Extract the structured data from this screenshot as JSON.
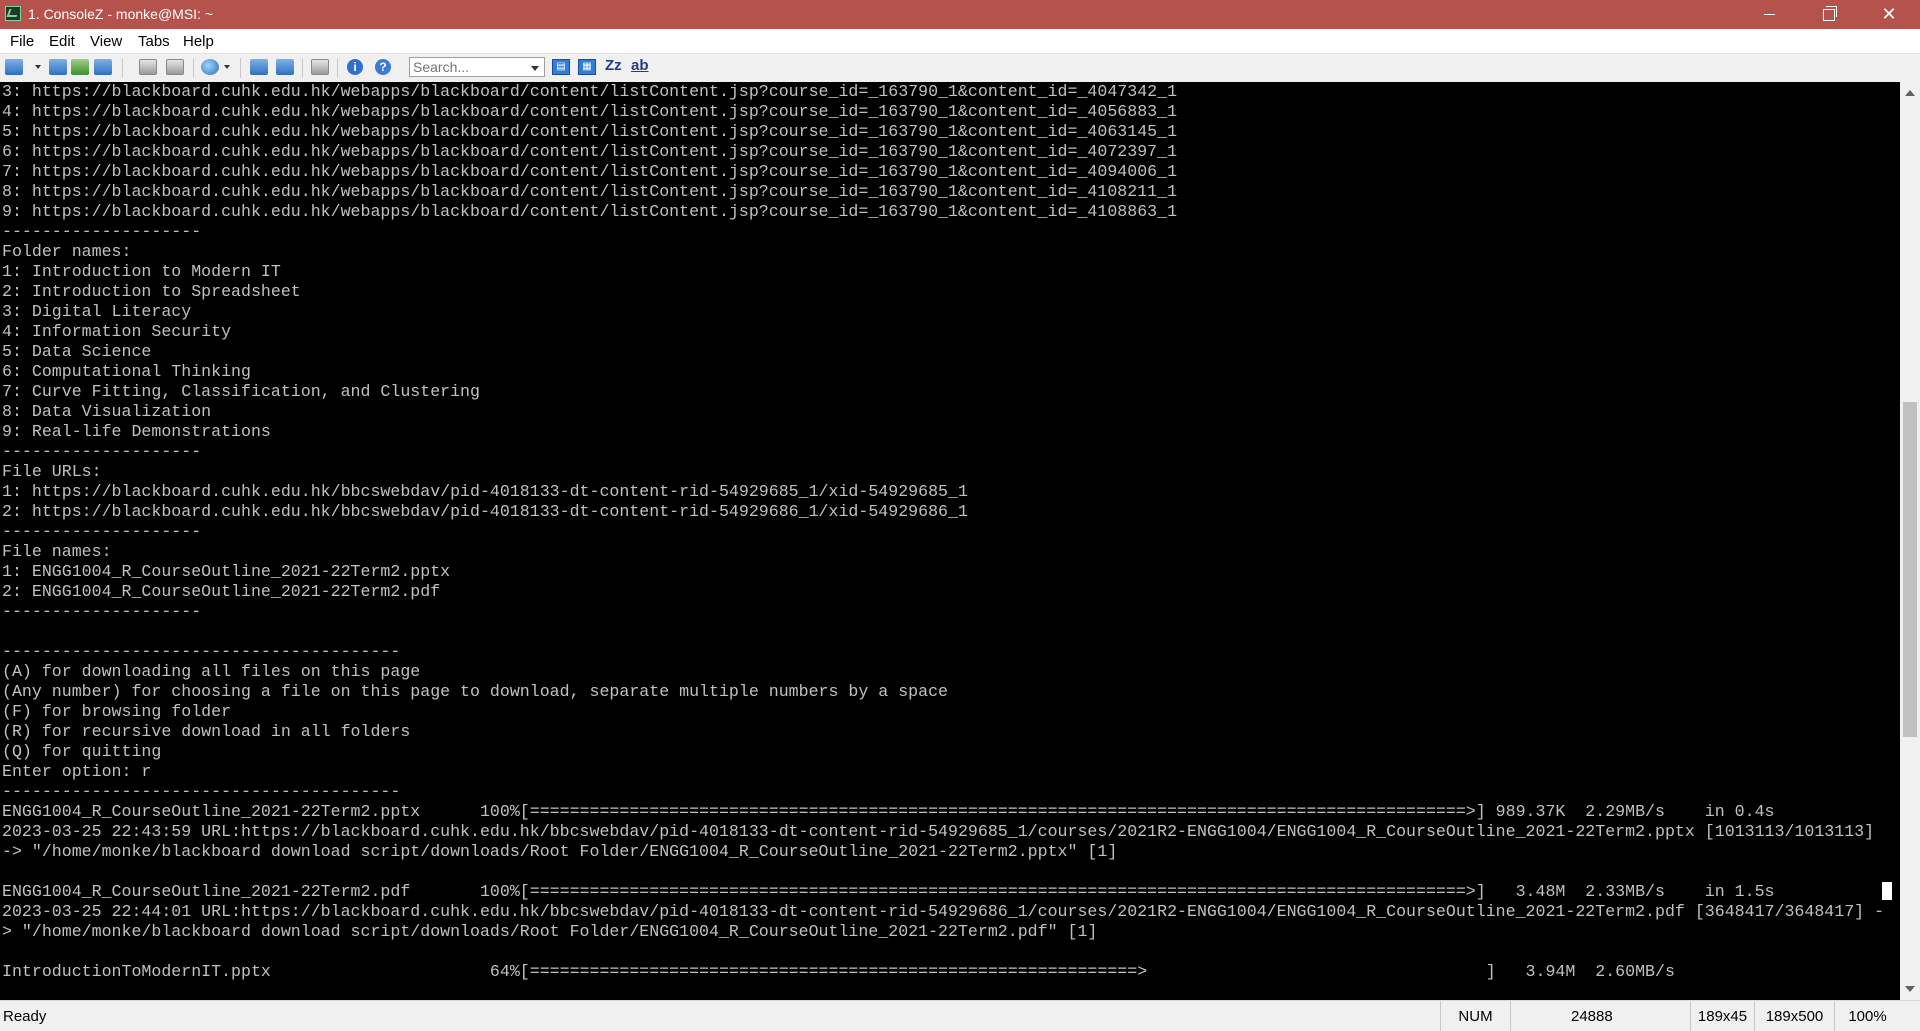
{
  "window": {
    "title": "1. ConsoleZ - monke@MSI: ~"
  },
  "menu": [
    "File",
    "Edit",
    "View",
    "Tabs",
    "Help"
  ],
  "toolbar": {
    "search_placeholder": "Search...",
    "text_buttons": [
      "Zz",
      "ab"
    ]
  },
  "terminal": {
    "lines": [
      "3: https://blackboard.cuhk.edu.hk/webapps/blackboard/content/listContent.jsp?course_id=_163790_1&content_id=_4047342_1",
      "4: https://blackboard.cuhk.edu.hk/webapps/blackboard/content/listContent.jsp?course_id=_163790_1&content_id=_4056883_1",
      "5: https://blackboard.cuhk.edu.hk/webapps/blackboard/content/listContent.jsp?course_id=_163790_1&content_id=_4063145_1",
      "6: https://blackboard.cuhk.edu.hk/webapps/blackboard/content/listContent.jsp?course_id=_163790_1&content_id=_4072397_1",
      "7: https://blackboard.cuhk.edu.hk/webapps/blackboard/content/listContent.jsp?course_id=_163790_1&content_id=_4094006_1",
      "8: https://blackboard.cuhk.edu.hk/webapps/blackboard/content/listContent.jsp?course_id=_163790_1&content_id=_4108211_1",
      "9: https://blackboard.cuhk.edu.hk/webapps/blackboard/content/listContent.jsp?course_id=_163790_1&content_id=_4108863_1",
      "--------------------",
      "Folder names:",
      "1: Introduction to Modern IT",
      "2: Introduction to Spreadsheet",
      "3: Digital Literacy",
      "4: Information Security",
      "5: Data Science",
      "6: Computational Thinking",
      "7: Curve Fitting, Classification, and Clustering",
      "8: Data Visualization",
      "9: Real-life Demonstrations",
      "--------------------",
      "File URLs:",
      "1: https://blackboard.cuhk.edu.hk/bbcswebdav/pid-4018133-dt-content-rid-54929685_1/xid-54929685_1",
      "2: https://blackboard.cuhk.edu.hk/bbcswebdav/pid-4018133-dt-content-rid-54929686_1/xid-54929686_1",
      "--------------------",
      "File names:",
      "1: ENGG1004_R_CourseOutline_2021-22Term2.pptx",
      "2: ENGG1004_R_CourseOutline_2021-22Term2.pdf",
      "--------------------",
      "",
      "----------------------------------------",
      "(A) for downloading all files on this page",
      "(Any number) for choosing a file on this page to download, separate multiple numbers by a space",
      "(F) for browsing folder",
      "(R) for recursive download in all folders",
      "(Q) for quitting",
      "Enter option: r",
      "----------------------------------------",
      "ENGG1004_R_CourseOutline_2021-22Term2.pptx      100%[==============================================================================================>] 989.37K  2.29MB/s    in 0.4s",
      "2023-03-25 22:43:59 URL:https://blackboard.cuhk.edu.hk/bbcswebdav/pid-4018133-dt-content-rid-54929685_1/courses/2021R2-ENGG1004/ENGG1004_R_CourseOutline_2021-22Term2.pptx [1013113/1013113]",
      "-> \"/home/monke/blackboard download script/downloads/Root Folder/ENGG1004_R_CourseOutline_2021-22Term2.pptx\" [1]",
      "",
      "ENGG1004_R_CourseOutline_2021-22Term2.pdf       100%[==============================================================================================>]   3.48M  2.33MB/s    in 1.5s",
      "2023-03-25 22:44:01 URL:https://blackboard.cuhk.edu.hk/bbcswebdav/pid-4018133-dt-content-rid-54929686_1/courses/2021R2-ENGG1004/ENGG1004_R_CourseOutline_2021-22Term2.pdf [3648417/3648417] -",
      "> \"/home/monke/blackboard download script/downloads/Root Folder/ENGG1004_R_CourseOutline_2021-22Term2.pdf\" [1]",
      "",
      "IntroductionToModernIT.pptx                      64%[=============================================================>                                  ]   3.94M  2.60MB/s"
    ]
  },
  "status": {
    "ready": "Ready",
    "num": "NUM",
    "value": "24888",
    "size1": "189x45",
    "size2": "189x500",
    "zoom": "100%"
  }
}
